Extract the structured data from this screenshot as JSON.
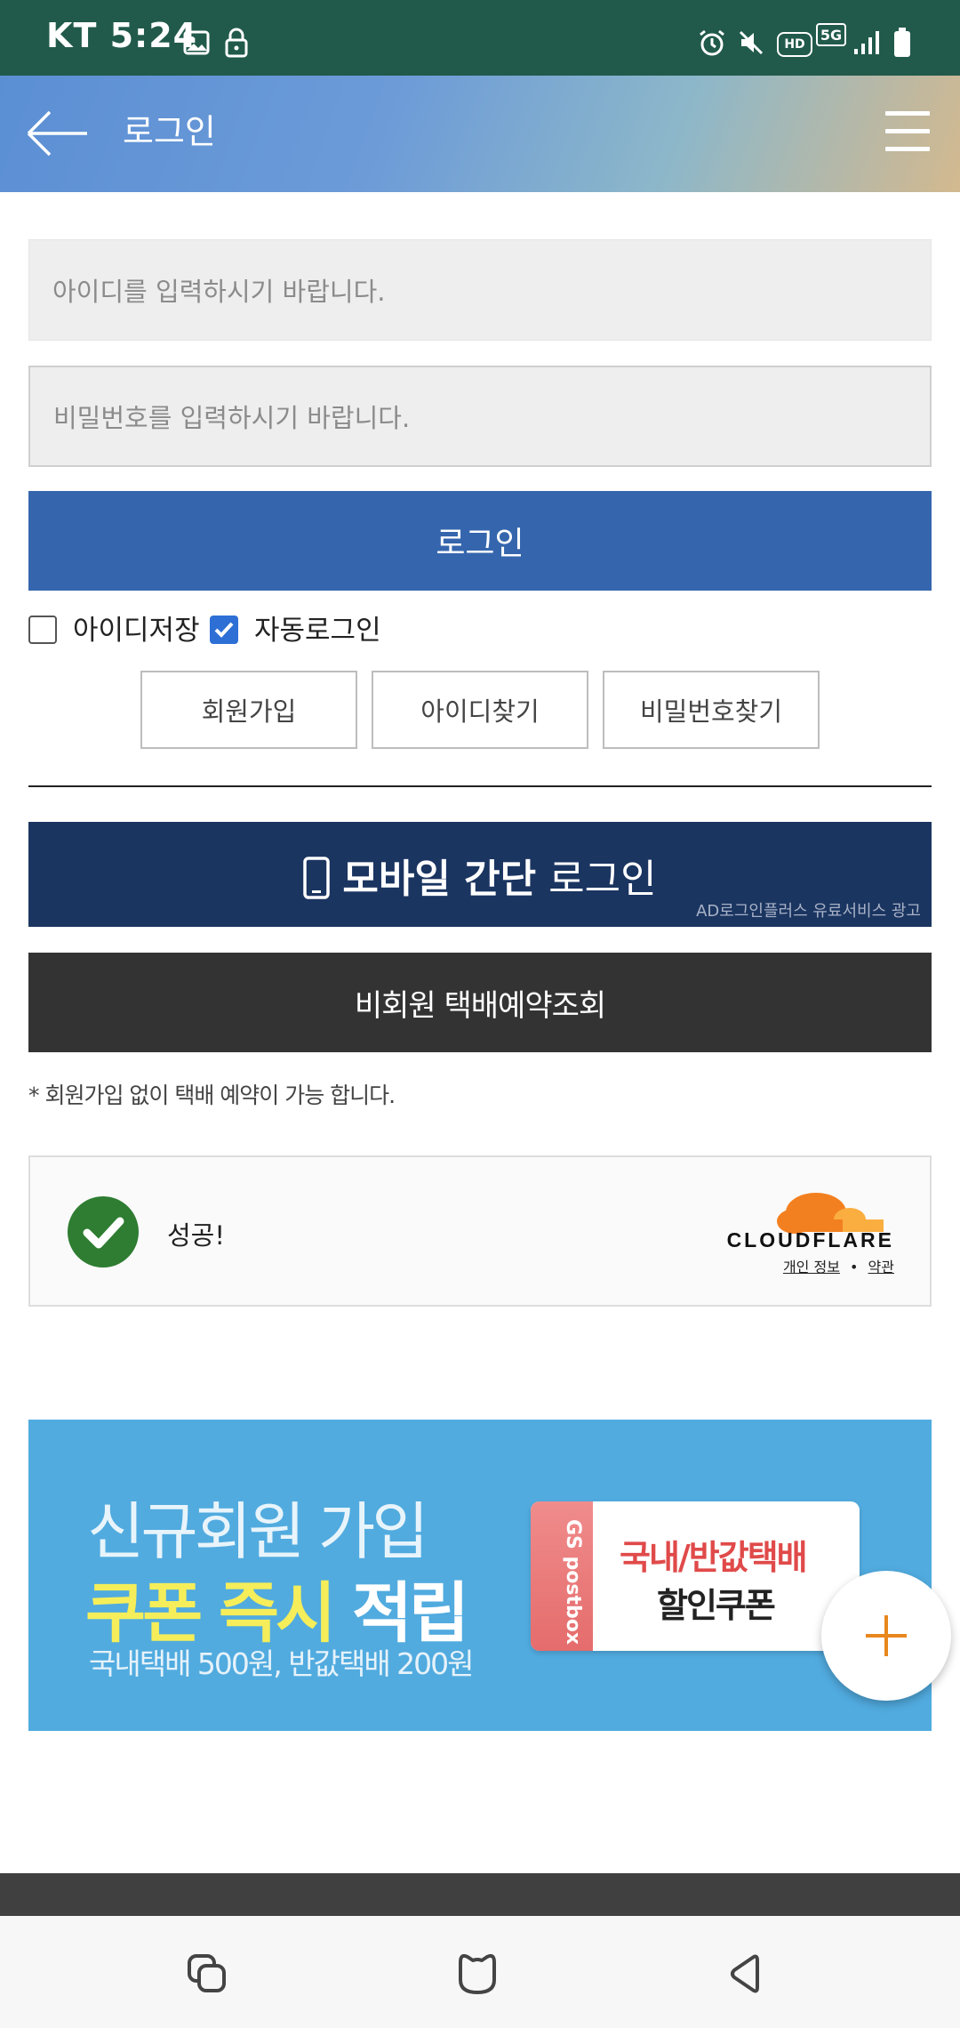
{
  "status_bar": {
    "carrier_time": "KT 5:24",
    "icons": [
      "image-icon",
      "lock-icon",
      "alarm-icon",
      "mute-icon",
      "hd-icon",
      "5g-icon",
      "signal-icon",
      "battery-icon"
    ],
    "hd": "HD",
    "net": "5G"
  },
  "header": {
    "title": "로그인"
  },
  "form": {
    "id_placeholder": "아이디를 입력하시기 바랍니다.",
    "pw_placeholder": "비밀번호를 입력하시기 바랍니다.",
    "login_label": "로그인",
    "save_id_label": "아이디저장",
    "save_id_checked": false,
    "auto_login_label": "자동로그인",
    "auto_login_checked": true,
    "links": [
      "회원가입",
      "아이디찾기",
      "비밀번호찾기"
    ]
  },
  "mobile_login": {
    "bold": "모바일 간단",
    "normal": "로그인",
    "ad": "AD로그인플러스 유료서비스 광고"
  },
  "guest": {
    "label": "비회원 택배예약조회",
    "note": "* 회원가입 없이 택배 예약이 가능 합니다."
  },
  "captcha": {
    "status": "성공!",
    "brand": "CLOUDFLARE",
    "privacy": "개인 정보",
    "sep": "•",
    "terms": "약관"
  },
  "banner": {
    "line1": "신규회원 가입",
    "line2_a": "쿠폰 즉시",
    "line2_b": "적립",
    "line3": "국내택배 500원, 반값택배 200원",
    "coupon_brand": "GS postbox",
    "coupon_title": "국내/반값택배",
    "coupon_sub": "할인쿠폰",
    "colors": {
      "bg": "#51abdf",
      "highlight": "#f5ee5a",
      "coupon_red": "#e04a4a"
    }
  },
  "fab": {
    "icon": "plus-icon",
    "color": "#e8871e"
  },
  "nav": {
    "icons": [
      "recent-apps-icon",
      "home-icon",
      "back-icon"
    ]
  }
}
